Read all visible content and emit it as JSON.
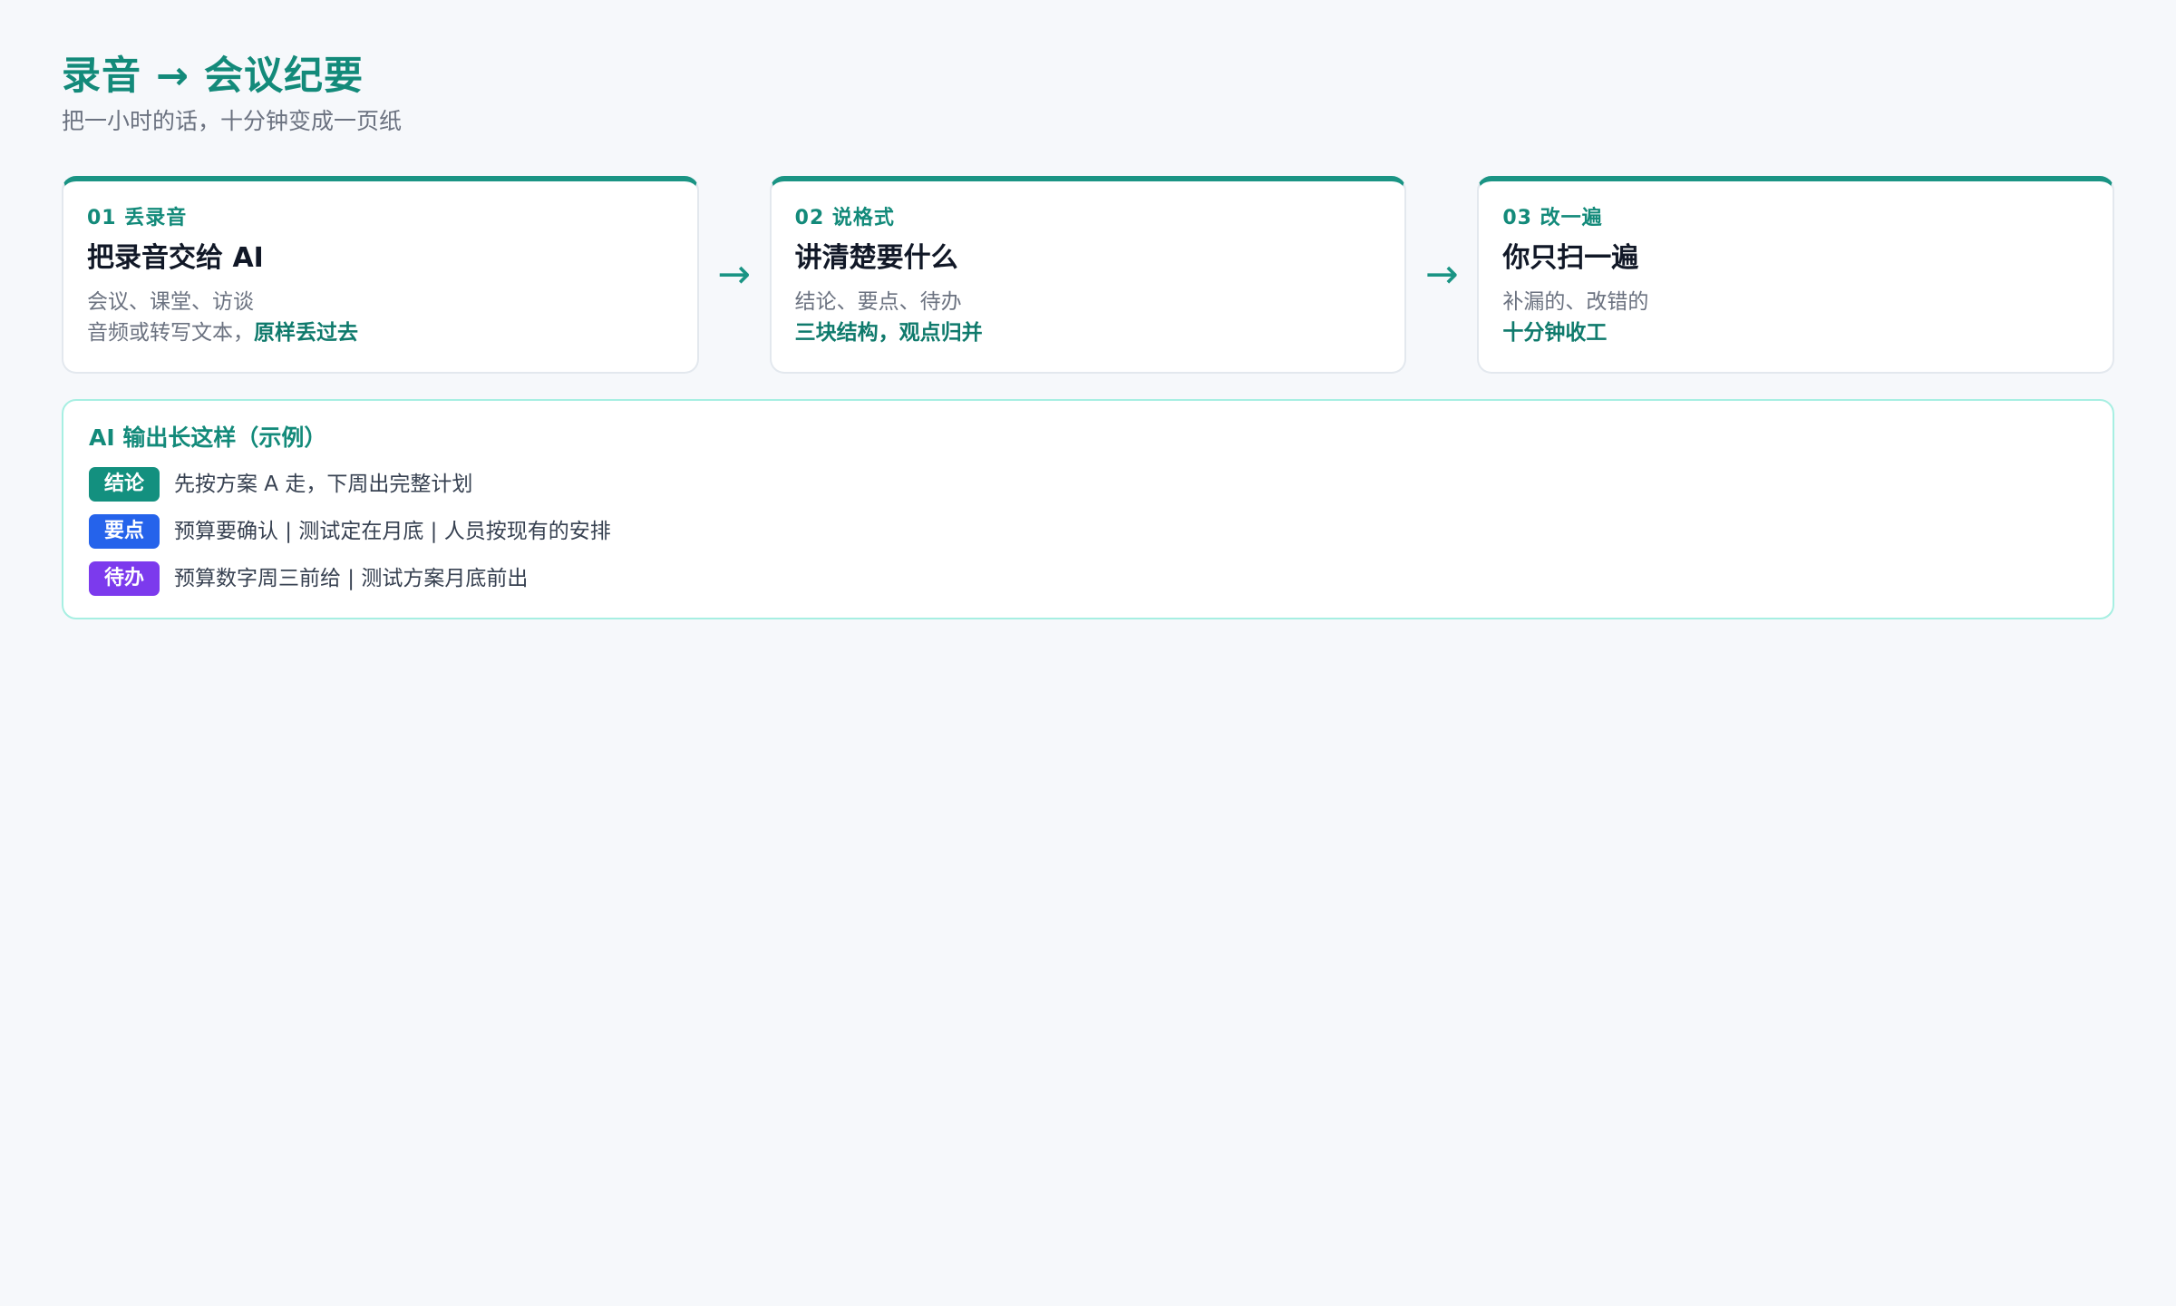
{
  "header": {
    "title": "录音 → 会议纪要",
    "subtitle": "把一小时的话，十分钟变成一页纸"
  },
  "steps": [
    {
      "kicker": "01 丢录音",
      "heading": "把录音交给 AI",
      "line1": "会议、课堂、访谈",
      "line2_prefix": "音频或转写文本，",
      "line2_em": "原样丢过去"
    },
    {
      "kicker": "02 说格式",
      "heading": "讲清楚要什么",
      "line1": "结论、要点、待办",
      "line2_em": "三块结构，观点归并"
    },
    {
      "kicker": "03 改一遍",
      "heading": "你只扫一遍",
      "line1": "补漏的、改错的",
      "line2_em": "十分钟收工"
    }
  ],
  "arrow_glyph": "→",
  "example": {
    "title": "AI 输出长这样（示例）",
    "rows": [
      {
        "tag": "结论",
        "text": "先按方案 A 走，下周出完整计划",
        "color": "#13907f"
      },
      {
        "tag": "要点",
        "text": "预算要确认 | 测试定在月底 | 人员按现有的安排",
        "color": "#2563eb"
      },
      {
        "tag": "待办",
        "text": "预算数字周三前给 | 测试方案月底前出",
        "color": "#7c3aed"
      }
    ]
  },
  "colors": {
    "accent": "#138a7a",
    "background": "#f6f8fb"
  }
}
